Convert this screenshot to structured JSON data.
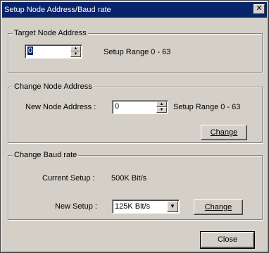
{
  "window": {
    "title": "Setup Node Address/Baud rate",
    "close_glyph": "✕"
  },
  "target_group": {
    "label": "Target Node Address",
    "value": "0",
    "range_text": "Setup Range 0 - 63"
  },
  "change_node_group": {
    "label": "Change Node Address",
    "field_label": "New Node Address :",
    "value": "0",
    "range_text": "Setup Range 0 - 63",
    "button_label": "Change"
  },
  "baud_group": {
    "label": "Change Baud rate",
    "current_label": "Current Setup :",
    "current_value": "500K Bit/s",
    "new_label": "New Setup :",
    "selected": "125K Bit/s",
    "button_label": "Change"
  },
  "footer": {
    "close_label": "Close"
  },
  "icons": {
    "spin_up": "▲",
    "spin_down": "▼",
    "dropdown": "▼"
  }
}
